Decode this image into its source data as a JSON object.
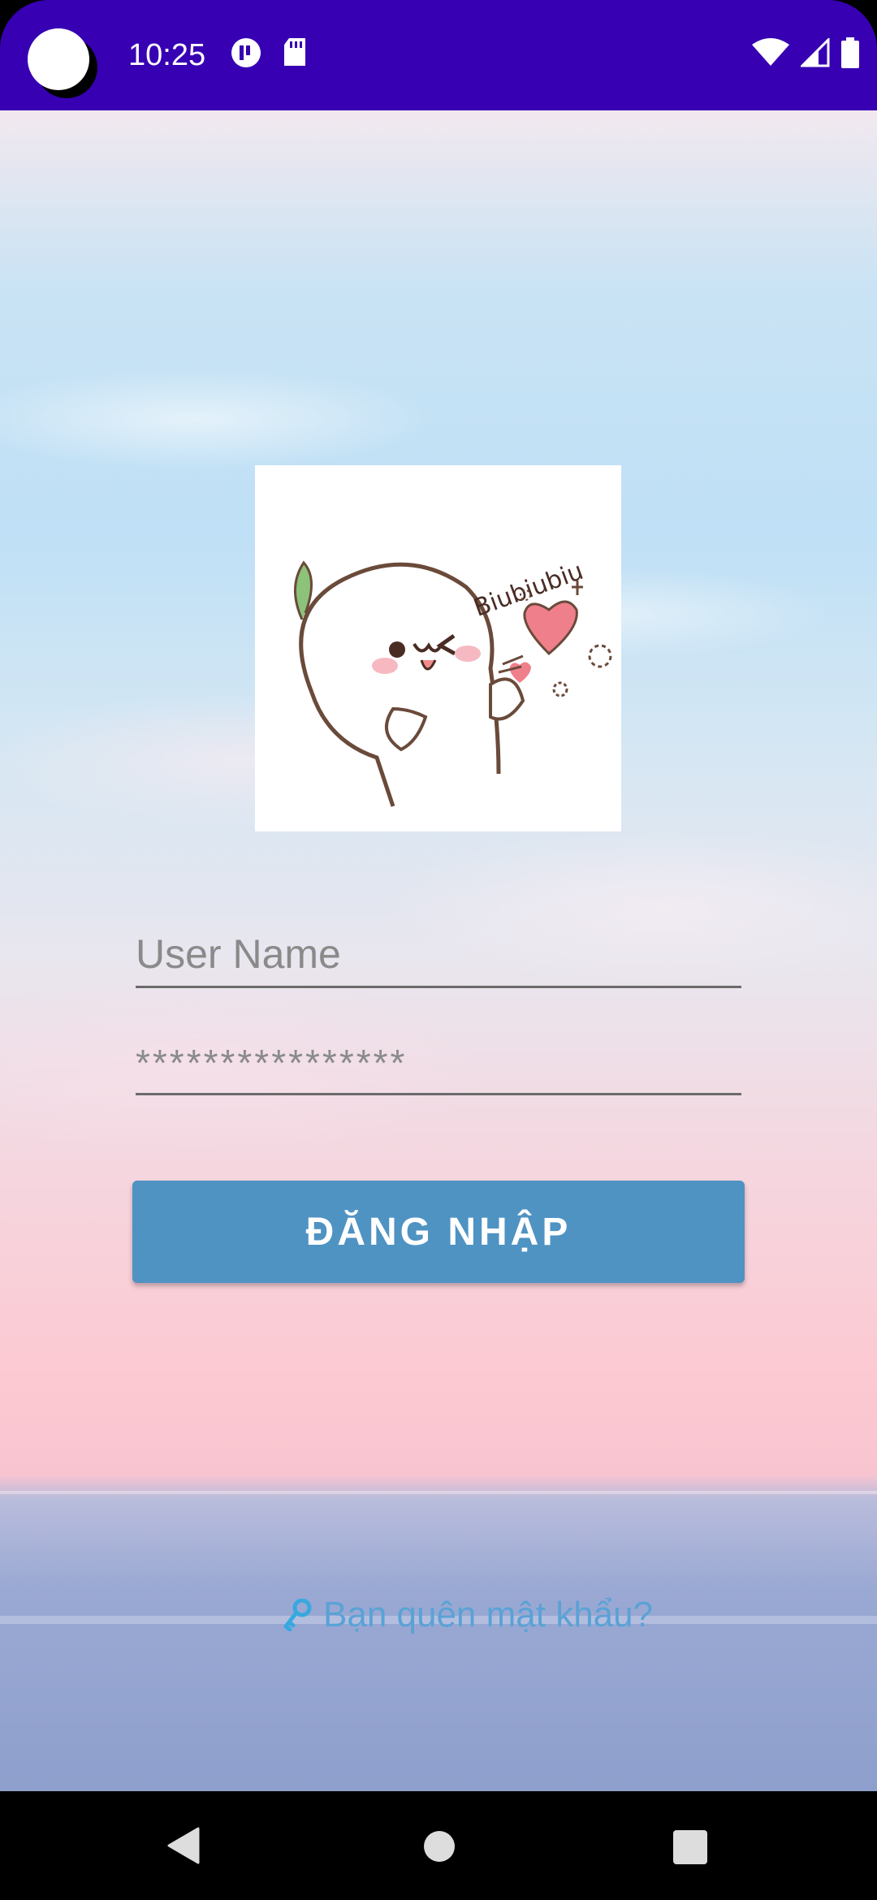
{
  "status_bar": {
    "time": "10:25",
    "left_icons": [
      "camera-cutout",
      "app-notification-icon",
      "sd-card-icon"
    ],
    "right_icons": [
      "wifi-icon",
      "cell-signal-icon",
      "battery-icon"
    ],
    "background_color": "#3700b3"
  },
  "login": {
    "logo_icon": "cartoon-blowing-kiss-image",
    "logo_text": "Biubiubiu",
    "username_placeholder": "User Name",
    "password_value": "****************",
    "login_button_label": "ĐĂNG NHẬP",
    "forgot_password_label": "Bạn quên mật khẩu?",
    "forgot_password_icon": "key-icon",
    "button_color": "#4f93c3",
    "link_color": "#5aa2d6"
  },
  "nav_bar": {
    "buttons": [
      "back-icon",
      "home-icon",
      "recents-icon"
    ]
  }
}
